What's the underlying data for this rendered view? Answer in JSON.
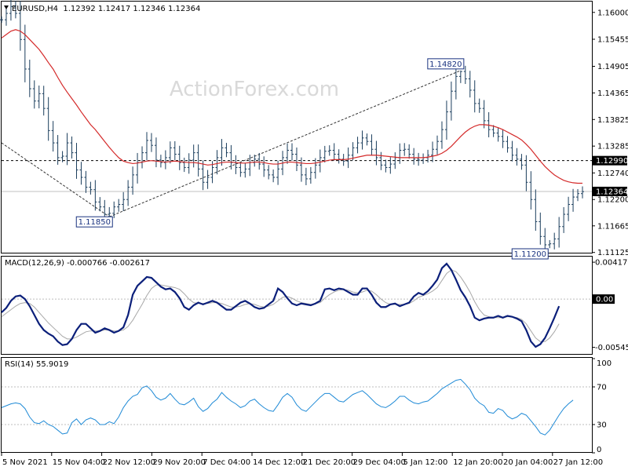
{
  "chart_data": {
    "type": "line",
    "watermark": "ActionForex.com",
    "x_ticks": [
      "5 Nov 2021",
      "15 Nov 04:00",
      "22 Nov 12:00",
      "29 Nov 20:00",
      "7 Dec 04:00",
      "14 Dec 12:00",
      "21 Dec 20:00",
      "29 Dec 04:00",
      "5 Jan 12:00",
      "12 Jan 20:00",
      "20 Jan 04:00",
      "27 Jan 12:00"
    ],
    "panels": [
      {
        "id": "price",
        "header": "EURUSD,H4  1.12392 1.12417 1.12346 1.12364",
        "ylim": [
          1.1112,
          1.1622
        ],
        "y_ticks": [
          1.16,
          1.15455,
          1.14905,
          1.14365,
          1.13825,
          1.13285,
          1.1274,
          1.122,
          1.11665,
          1.11125
        ],
        "current_value": "1.12364",
        "current_value_num": 1.12364,
        "dashed_level": "1.12990",
        "dashed_level_num": 1.1299,
        "series": [
          {
            "style": "ohlc-bars",
            "color": "#1a3d5c",
            "close": [
              1.1585,
              1.1598,
              1.1612,
              1.1598,
              1.1545,
              1.1485,
              1.1445,
              1.142,
              1.1435,
              1.1405,
              1.136,
              1.1335,
              1.1305,
              1.1308,
              1.1335,
              1.1315,
              1.128,
              1.1265,
              1.1245,
              1.124,
              1.1215,
              1.1205,
              1.119,
              1.1192,
              1.1205,
              1.121,
              1.122,
              1.1245,
              1.127,
              1.1295,
              1.1315,
              1.134,
              1.133,
              1.13,
              1.1295,
              1.1305,
              1.1325,
              1.1312,
              1.1295,
              1.1285,
              1.13,
              1.1315,
              1.1282,
              1.1255,
              1.1265,
              1.1285,
              1.1305,
              1.1325,
              1.1315,
              1.1295,
              1.1285,
              1.1275,
              1.1282,
              1.1295,
              1.1302,
              1.1292,
              1.128,
              1.127,
              1.1265,
              1.1282,
              1.1305,
              1.132,
              1.1312,
              1.129,
              1.127,
              1.1262,
              1.1275,
              1.129,
              1.1305,
              1.1318,
              1.132,
              1.1312,
              1.1302,
              1.1298,
              1.131,
              1.1325,
              1.1335,
              1.1345,
              1.1338,
              1.1322,
              1.1305,
              1.129,
              1.1285,
              1.1292,
              1.1305,
              1.132,
              1.1322,
              1.1312,
              1.1302,
              1.13,
              1.1305,
              1.131,
              1.1322,
              1.1338,
              1.1362,
              1.1398,
              1.144,
              1.147,
              1.148,
              1.1465,
              1.1442,
              1.1415,
              1.1405,
              1.138,
              1.1362,
              1.1355,
              1.1348,
              1.1338,
              1.1325,
              1.131,
              1.1302,
              1.129,
              1.1255,
              1.122,
              1.1175,
              1.1145,
              1.1128,
              1.113,
              1.114,
              1.1165,
              1.119,
              1.121,
              1.1225,
              1.1232,
              1.1236
            ]
          },
          {
            "style": "moving-average",
            "color": "#d42a2a",
            "values": [
              1.1548,
              1.1555,
              1.1562,
              1.1565,
              1.1562,
              1.1555,
              1.1545,
              1.1535,
              1.1525,
              1.1512,
              1.1498,
              1.1485,
              1.1468,
              1.1452,
              1.1438,
              1.1425,
              1.1412,
              1.1398,
              1.1385,
              1.1372,
              1.1362,
              1.135,
              1.1338,
              1.1326,
              1.1315,
              1.1305,
              1.1298,
              1.1295,
              1.1293,
              1.1294,
              1.1296,
              1.1298,
              1.1299,
              1.1298,
              1.1297,
              1.1296,
              1.1297,
              1.1298,
              1.1297,
              1.1296,
              1.1295,
              1.1295,
              1.1294,
              1.1292,
              1.129,
              1.1291,
              1.1293,
              1.1295,
              1.1296,
              1.1296,
              1.1295,
              1.1294,
              1.1294,
              1.1295,
              1.1296,
              1.1296,
              1.1295,
              1.1293,
              1.1292,
              1.1292,
              1.1294,
              1.1296,
              1.1296,
              1.1295,
              1.1294,
              1.1293,
              1.1293,
              1.1294,
              1.1296,
              1.1298,
              1.13,
              1.1301,
              1.1301,
              1.1301,
              1.1302,
              1.1304,
              1.1306,
              1.1308,
              1.131,
              1.131,
              1.131,
              1.1309,
              1.1308,
              1.1307,
              1.1306,
              1.1305,
              1.1305,
              1.1305,
              1.1305,
              1.1305,
              1.1305,
              1.1306,
              1.1308,
              1.131,
              1.1314,
              1.132,
              1.1328,
              1.1338,
              1.1348,
              1.1357,
              1.1364,
              1.1369,
              1.1372,
              1.1372,
              1.1371,
              1.1369,
              1.1366,
              1.1362,
              1.1357,
              1.1352,
              1.1347,
              1.1341,
              1.1332,
              1.1322,
              1.131,
              1.1298,
              1.1287,
              1.1278,
              1.127,
              1.1264,
              1.1259,
              1.1256,
              1.1254,
              1.1253,
              1.1253
            ]
          }
        ],
        "annotations": [
          {
            "label": "1.11850",
            "value": 1.1185,
            "bar": 23,
            "position": "below"
          },
          {
            "label": "1.14820",
            "value": 1.1482,
            "bar": 98,
            "position": "above"
          },
          {
            "label": "1.11200",
            "value": 1.112,
            "bar": 116,
            "position": "below"
          }
        ],
        "trendlines": [
          {
            "style": "dashed",
            "from": {
              "bar": 0,
              "value": 1.1335
            },
            "to": {
              "bar": 23,
              "value": 1.1185
            }
          },
          {
            "style": "dashed",
            "from": {
              "bar": 23,
              "value": 1.1185
            },
            "to": {
              "bar": 98,
              "value": 1.1482
            }
          }
        ]
      },
      {
        "id": "macd",
        "header": "MACD(12,26,9) -0.000766 -0.002617",
        "ylim": [
          -0.0062,
          0.0048
        ],
        "y_ticks": [
          "0.00417",
          "0.00",
          "-0.005456"
        ],
        "y_tick_values": [
          0.00417,
          0.0,
          -0.005456
        ],
        "current_value": "0.00",
        "zero_line": 0,
        "series": [
          {
            "name": "MACD",
            "color": "#0b1f7a",
            "values": [
              -0.0015,
              -0.001,
              -0.0002,
              0.0003,
              0.0004,
              0.0,
              -0.0008,
              -0.0018,
              -0.0028,
              -0.0035,
              -0.0039,
              -0.0042,
              -0.0048,
              -0.0052,
              -0.0051,
              -0.0045,
              -0.0035,
              -0.0028,
              -0.0028,
              -0.0033,
              -0.0038,
              -0.0036,
              -0.0033,
              -0.0035,
              -0.0038,
              -0.0036,
              -0.0032,
              -0.0018,
              0.0005,
              0.0015,
              0.002,
              0.0025,
              0.0024,
              0.0019,
              0.0014,
              0.0011,
              0.0012,
              0.0008,
              0.0001,
              -0.0009,
              -0.0012,
              -0.0007,
              -0.0004,
              -0.0006,
              -0.0004,
              -0.0002,
              -0.0004,
              -0.0008,
              -0.0012,
              -0.0012,
              -0.0008,
              -0.0004,
              -0.0002,
              -0.0005,
              -0.0009,
              -0.0011,
              -0.001,
              -0.0006,
              -0.0002,
              0.0012,
              0.0008,
              0.0001,
              -0.0005,
              -0.0007,
              -0.0005,
              -0.0006,
              -0.0007,
              -0.0005,
              -0.0002,
              0.0011,
              0.0012,
              0.001,
              0.0012,
              0.0011,
              0.0008,
              0.0005,
              0.0005,
              0.0012,
              0.0012,
              0.0005,
              -0.0004,
              -0.0009,
              -0.0009,
              -0.0006,
              -0.0005,
              -0.0008,
              -0.0006,
              -0.0004,
              0.0003,
              0.0007,
              0.0005,
              0.0009,
              0.0015,
              0.0022,
              0.0035,
              0.004,
              0.0033,
              0.0022,
              0.001,
              0.0002,
              -0.0008,
              -0.0021,
              -0.0024,
              -0.0022,
              -0.0021,
              -0.0021,
              -0.0019,
              -0.0021,
              -0.0019,
              -0.002,
              -0.0022,
              -0.0025,
              -0.0035,
              -0.0048,
              -0.0054,
              -0.0051,
              -0.0044,
              -0.0033,
              -0.0021,
              -0.0008
            ]
          },
          {
            "name": "Signal",
            "color": "#a8a8a8",
            "values": [
              -0.002,
              -0.0016,
              -0.0012,
              -0.0008,
              -0.0005,
              -0.0004,
              -0.0005,
              -0.0009,
              -0.0015,
              -0.0021,
              -0.0027,
              -0.0032,
              -0.0037,
              -0.0042,
              -0.0045,
              -0.0045,
              -0.0043,
              -0.004,
              -0.0037,
              -0.0036,
              -0.0036,
              -0.0036,
              -0.0035,
              -0.0035,
              -0.0036,
              -0.0036,
              -0.0035,
              -0.0031,
              -0.0024,
              -0.0015,
              -0.0006,
              0.0004,
              0.0012,
              0.0016,
              0.0016,
              0.0015,
              0.0014,
              0.0013,
              0.0011,
              0.0006,
              0.0,
              -0.0004,
              -0.0005,
              -0.0005,
              -0.0005,
              -0.0004,
              -0.0004,
              -0.0005,
              -0.0007,
              -0.0009,
              -0.0009,
              -0.0008,
              -0.0006,
              -0.0005,
              -0.0006,
              -0.0008,
              -0.0009,
              -0.0008,
              -0.0006,
              -0.0002,
              0.0002,
              0.0003,
              0.0001,
              -0.0002,
              -0.0004,
              -0.0005,
              -0.0006,
              -0.0005,
              -0.0004,
              0.0001,
              0.0005,
              0.0008,
              0.001,
              0.0011,
              0.001,
              0.0008,
              0.0007,
              0.0008,
              0.001,
              0.0009,
              0.0005,
              0.0,
              -0.0004,
              -0.0006,
              -0.0006,
              -0.0006,
              -0.0006,
              -0.0005,
              -0.0002,
              0.0002,
              0.0004,
              0.0006,
              0.0009,
              0.0013,
              0.0021,
              0.0029,
              0.0033,
              0.0031,
              0.0025,
              0.0017,
              0.0008,
              -0.0003,
              -0.0012,
              -0.0018,
              -0.002,
              -0.0021,
              -0.0021,
              -0.0021,
              -0.002,
              -0.002,
              -0.0021,
              -0.0023,
              -0.0028,
              -0.0036,
              -0.0044,
              -0.0048,
              -0.0048,
              -0.0044,
              -0.0037,
              -0.0028
            ]
          }
        ]
      },
      {
        "id": "rsi",
        "header": "RSI(14) 55.9019",
        "ylim": [
          0,
          100
        ],
        "y_ticks": [
          100,
          70,
          30,
          0
        ],
        "levels": [
          70,
          30
        ],
        "series": [
          {
            "name": "RSI",
            "color": "#1f8ad6",
            "values": [
              48,
              50,
              52,
              53,
              52,
              47,
              38,
              32,
              31,
              34,
              30,
              28,
              24,
              20,
              21,
              32,
              36,
              30,
              35,
              37,
              35,
              30,
              30,
              33,
              31,
              38,
              48,
              55,
              60,
              62,
              69,
              71,
              66,
              59,
              56,
              58,
              63,
              57,
              52,
              51,
              54,
              58,
              49,
              44,
              47,
              53,
              57,
              64,
              59,
              55,
              52,
              48,
              50,
              55,
              57,
              52,
              48,
              45,
              44,
              51,
              59,
              63,
              59,
              51,
              46,
              44,
              49,
              54,
              59,
              63,
              63,
              59,
              55,
              54,
              58,
              62,
              64,
              66,
              62,
              57,
              52,
              49,
              48,
              51,
              55,
              60,
              60,
              56,
              53,
              52,
              54,
              55,
              59,
              63,
              68,
              71,
              74,
              77,
              78,
              73,
              67,
              58,
              53,
              50,
              43,
              42,
              47,
              45,
              39,
              36,
              38,
              42,
              40,
              34,
              28,
              21,
              19,
              24,
              32,
              40,
              47,
              52,
              56
            ]
          }
        ]
      }
    ]
  }
}
